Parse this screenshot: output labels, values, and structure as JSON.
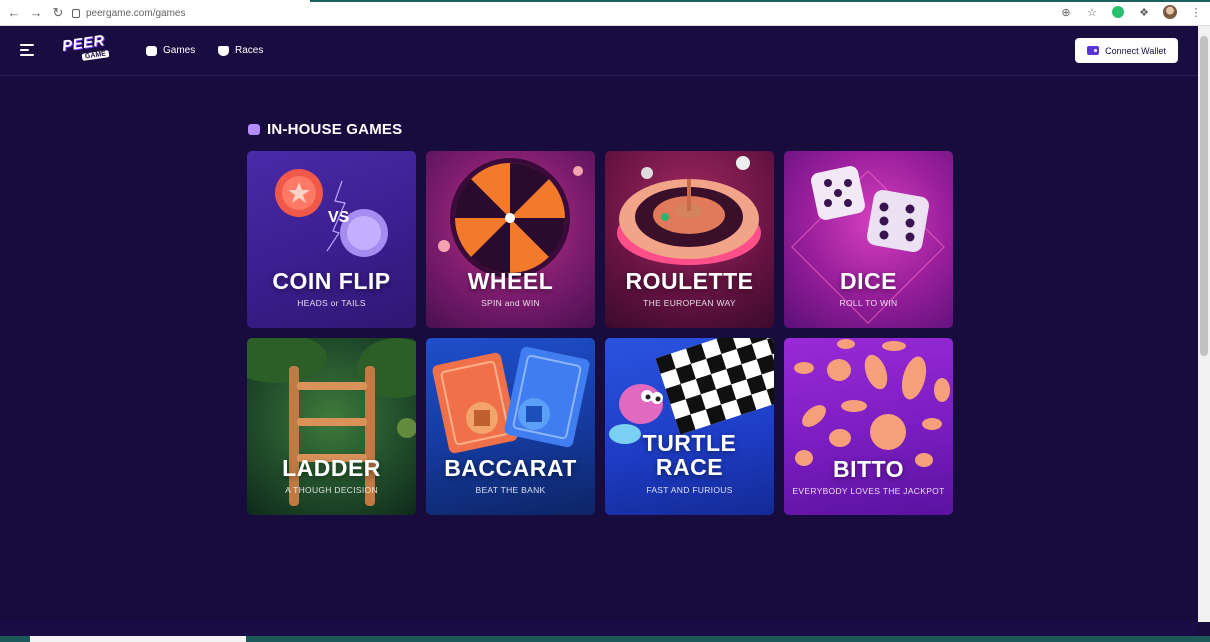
{
  "browser": {
    "url": "peergame.com/games"
  },
  "header": {
    "logo_top": "PEER",
    "logo_bottom": "GAME",
    "nav": [
      {
        "label": "Games"
      },
      {
        "label": "Races"
      }
    ],
    "connect_label": "Connect Wallet"
  },
  "section": {
    "title": "IN-HOUSE GAMES"
  },
  "games": [
    {
      "title": "COIN FLIP",
      "subtitle": "HEADS or TAILS"
    },
    {
      "title": "WHEEL",
      "subtitle": "SPIN and WIN"
    },
    {
      "title": "ROULETTE",
      "subtitle": "THE EUROPEAN WAY"
    },
    {
      "title": "DICE",
      "subtitle": "ROLL TO WIN"
    },
    {
      "title": "LADDER",
      "subtitle": "A THOUGH DECISION"
    },
    {
      "title": "BACCARAT",
      "subtitle": "BEAT THE BANK"
    },
    {
      "title_line1": "TURTLE",
      "title_line2": "RACE",
      "subtitle": "FAST AND FURIOUS"
    },
    {
      "title": "BITTO",
      "subtitle": "EVERYBODY LOVES THE JACKPOT"
    }
  ],
  "colors": {
    "background": "#180b3e",
    "accent": "#b48cff",
    "button_bg": "#ffffff"
  }
}
